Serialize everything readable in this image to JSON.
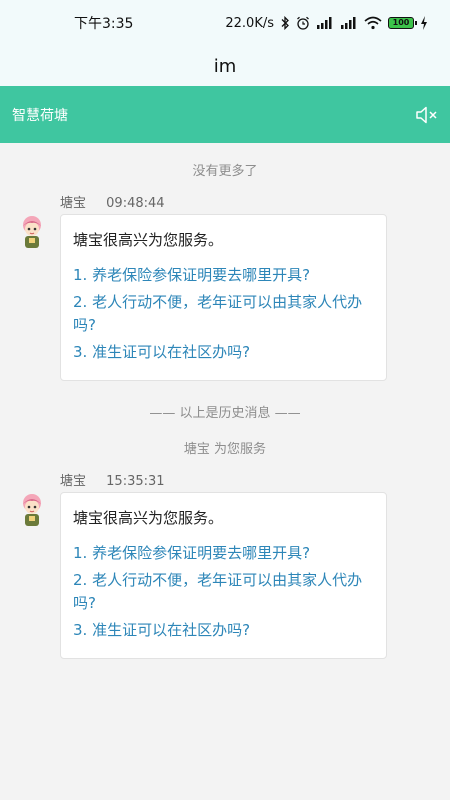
{
  "status_bar": {
    "time": "下午3:35",
    "net_speed": "22.0K/s",
    "battery": "100"
  },
  "app": {
    "title": "im"
  },
  "chat_header": {
    "title": "智慧荷塘",
    "mute_icon": "speaker-muted-icon"
  },
  "chat": {
    "no_more": "没有更多了",
    "history_divider": "—— 以上是历史消息 ——",
    "service_notice": "塘宝 为您服务",
    "messages": [
      {
        "sender": "塘宝",
        "time": "09:48:44",
        "greeting": "塘宝很高兴为您服务。",
        "links": [
          "1. 养老保险参保证明要去哪里开具?",
          "2. 老人行动不便，老年证可以由其家人代办吗?",
          "3. 准生证可以在社区办吗?"
        ]
      },
      {
        "sender": "塘宝",
        "time": "15:35:31",
        "greeting": "塘宝很高兴为您服务。",
        "links": [
          "1. 养老保险参保证明要去哪里开具?",
          "2. 老人行动不便，老年证可以由其家人代办吗?",
          "3. 准生证可以在社区办吗?"
        ]
      }
    ]
  },
  "colors": {
    "header_bg": "#3fc6a0",
    "link": "#2d86b8",
    "top_bg": "#f2fafb"
  }
}
